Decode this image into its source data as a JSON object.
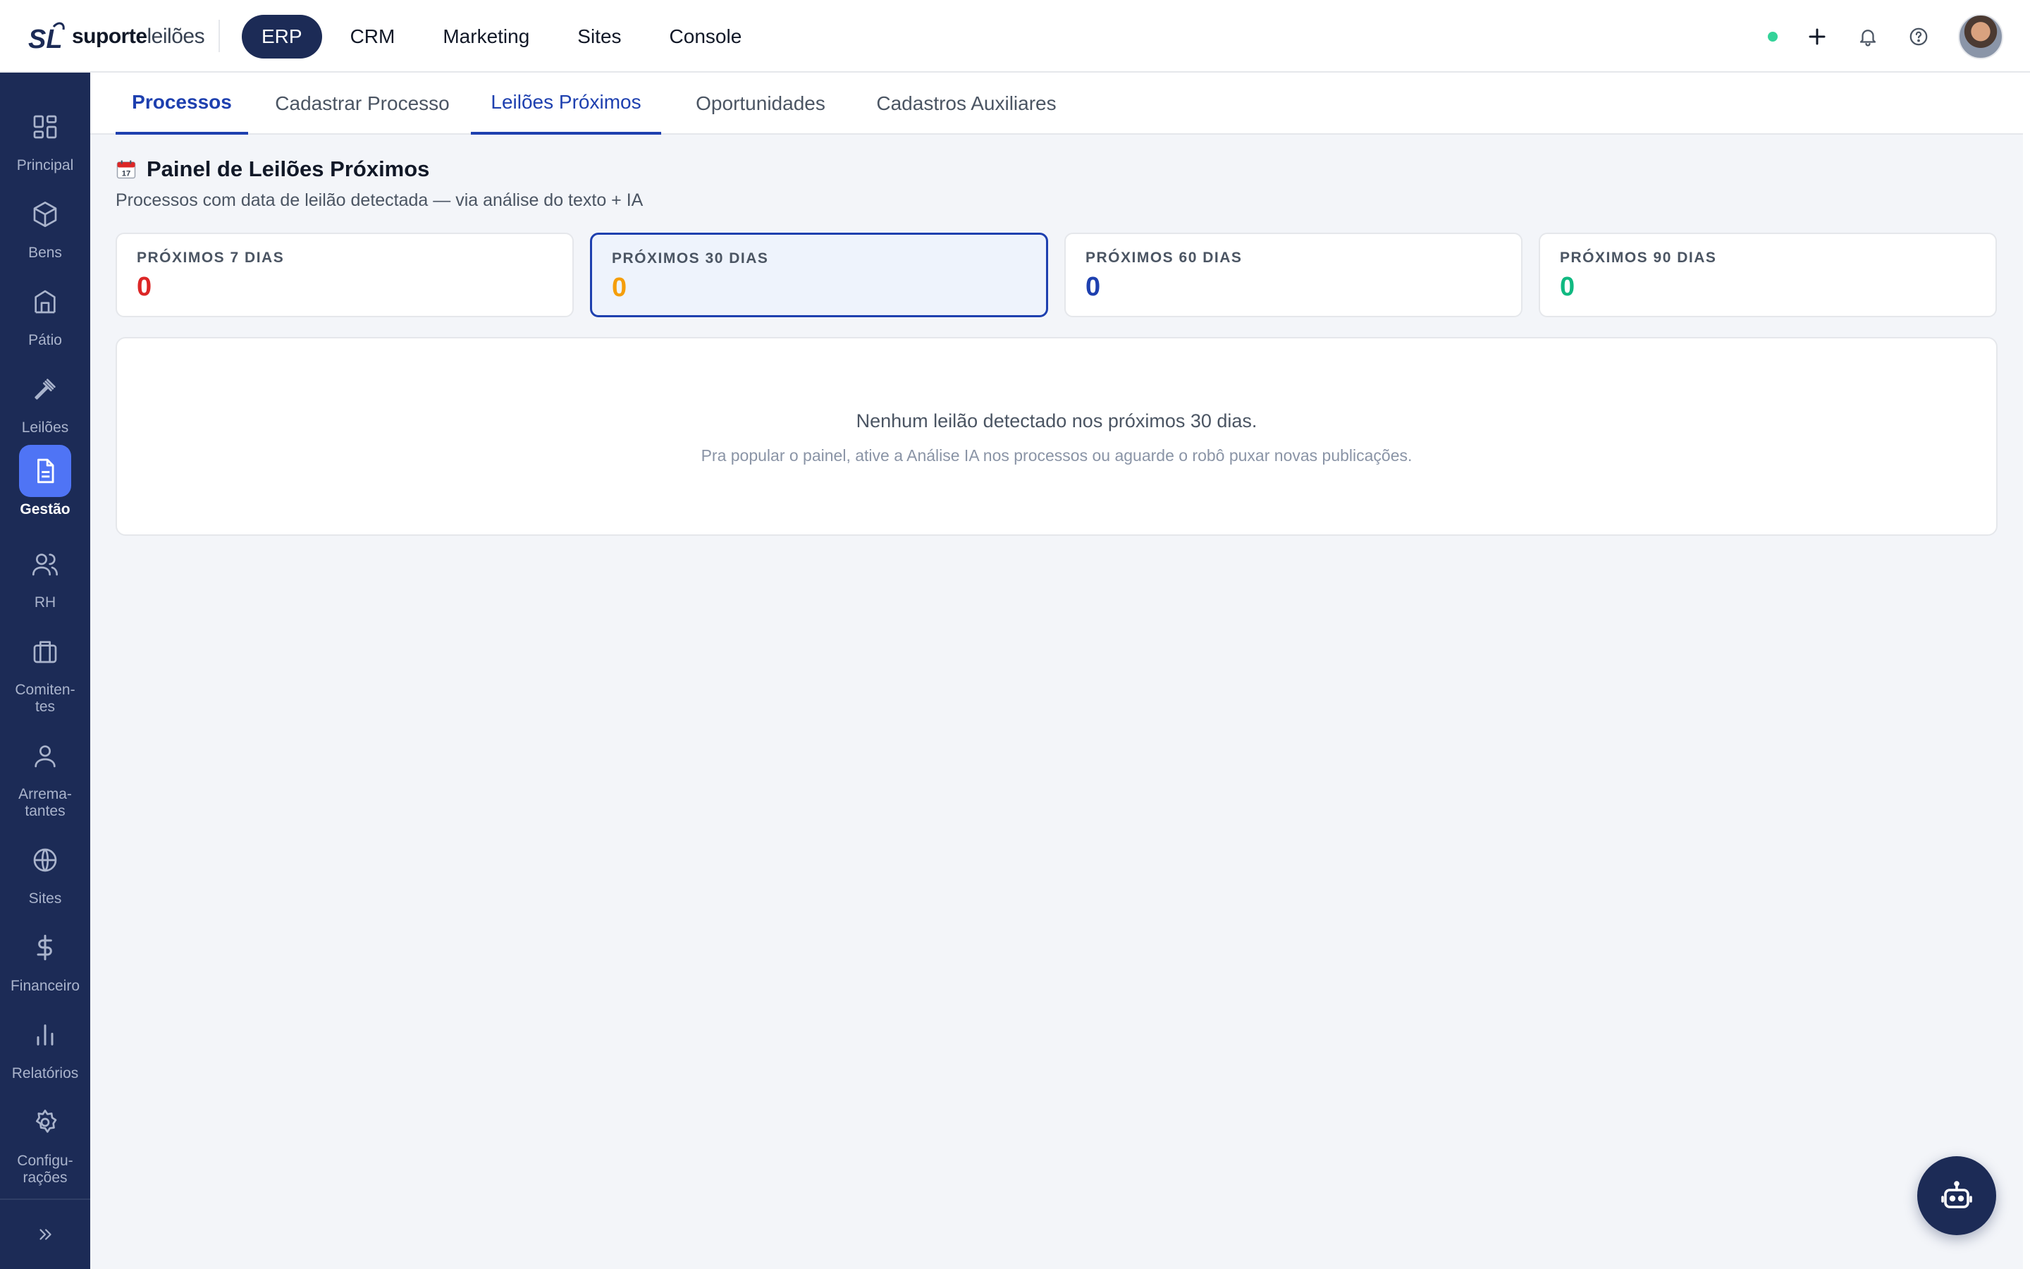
{
  "brand": {
    "mark": "SL",
    "name_bold": "suporte",
    "name_light": "leilões"
  },
  "modules": [
    {
      "label": "ERP"
    },
    {
      "label": "CRM"
    },
    {
      "label": "Marketing"
    },
    {
      "label": "Sites"
    },
    {
      "label": "Console"
    }
  ],
  "active_module": "ERP",
  "status": {
    "online_color": "#34d399"
  },
  "top_icons": [
    "plus-icon",
    "bell-icon",
    "help-icon",
    "avatar"
  ],
  "sidebar": {
    "items": [
      {
        "label": "Principal",
        "icon": "dashboard-icon"
      },
      {
        "label": "Bens",
        "icon": "box-icon"
      },
      {
        "label": "Pátio",
        "icon": "warehouse-icon"
      },
      {
        "label": "Leilões",
        "icon": "gavel-icon"
      },
      {
        "label": "Gestão",
        "icon": "document-icon",
        "active": true
      },
      {
        "label": "RH",
        "icon": "users-icon"
      },
      {
        "label": "Comiten-\ntes",
        "icon": "briefcase-icon"
      },
      {
        "label": "Arrema-\ntantes",
        "icon": "user-icon"
      },
      {
        "label": "Sites",
        "icon": "globe-icon"
      },
      {
        "label": "Financeiro",
        "icon": "dollar-icon"
      },
      {
        "label": "Relatórios",
        "icon": "bar-chart-icon"
      },
      {
        "label": "Configu-\nrações",
        "icon": "gear-icon"
      }
    ],
    "collapse_icon": "chevrons-right-icon"
  },
  "subtabs": [
    {
      "label": "Processos"
    },
    {
      "label": "Cadastrar Processo"
    },
    {
      "label": "Leilões Próximos"
    },
    {
      "label": "Oportunidades"
    },
    {
      "label": "Cadastros Auxiliares"
    }
  ],
  "panel": {
    "title_icon": "calendar-icon",
    "title": "Painel de Leilões Próximos",
    "subtitle": "Processos com data de leilão detectada — via análise do texto + IA"
  },
  "summary_cards": [
    {
      "label": "PRÓXIMOS 7 DIAS",
      "value": "0",
      "color": "#dc2626"
    },
    {
      "label": "PRÓXIMOS 30 DIAS",
      "value": "0",
      "color": "#f59e0b",
      "selected": true
    },
    {
      "label": "PRÓXIMOS 60 DIAS",
      "value": "0",
      "color": "#1e40af"
    },
    {
      "label": "PRÓXIMOS 90 DIAS",
      "value": "0",
      "color": "#10b981"
    }
  ],
  "empty_state": {
    "title": "Nenhum leilão detectado nos próximos 30 dias.",
    "hint": "Pra popular o painel, ative a Análise IA nos processos ou aguarde o robô puxar novas publicações."
  },
  "assistant": {
    "icon": "robot-icon"
  },
  "colors": {
    "navy": "#1c2b56",
    "accent": "#1e40af",
    "active_nav": "#4f74f5"
  }
}
